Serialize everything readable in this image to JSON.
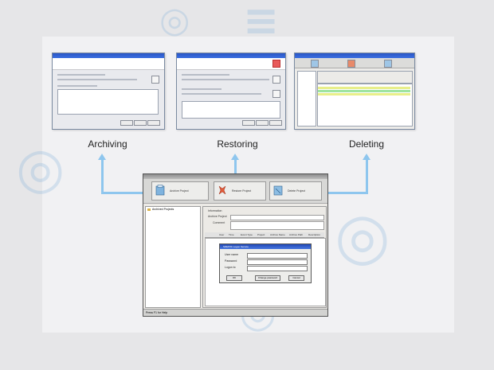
{
  "captions": {
    "archiving": "Archiving",
    "restoring": "Restoring",
    "deleting": "Deleting"
  },
  "main_window": {
    "toolbar": {
      "archive_label": "Archive Project",
      "restore_label": "Restore Project",
      "delete_label": "Delete Project"
    },
    "tree": {
      "root_label": "Archived Projects"
    },
    "panel": {
      "info_label": "Information",
      "archive_project_label": "Archive Project",
      "comment_label": "Comment"
    },
    "grid_columns": [
      "User",
      "Time",
      "Event Type",
      "Project",
      "Archive Name",
      "Archive Path",
      "Description"
    ],
    "login_dialog": {
      "title": "SIMATIC Logon Service",
      "user_name_label": "User name",
      "password_label": "Password",
      "logon_to_label": "Logon to",
      "ok_label": "OK",
      "change_password_label": "Change password",
      "cancel_label": "Cancel"
    },
    "status_text": "Press F1 for Help"
  },
  "colors": {
    "arrow": "#8ec6ee",
    "background": "#e6e6e8",
    "title_bar": "#2a56c6"
  }
}
